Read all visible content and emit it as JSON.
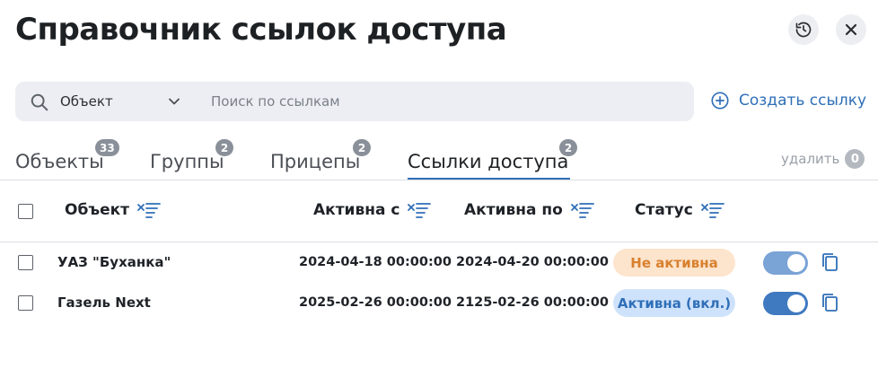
{
  "header": {
    "title": "Справочник ссылок доступа"
  },
  "search": {
    "object_label": "Объект",
    "placeholder": "Поиск по ссылкам"
  },
  "actions": {
    "create_label": "Создать ссылку",
    "delete_label": "удалить",
    "delete_count": "0"
  },
  "tabs": [
    {
      "label": "Объекты",
      "count": "33",
      "active": false
    },
    {
      "label": "Группы",
      "count": "2",
      "active": false
    },
    {
      "label": "Прицепы",
      "count": "2",
      "active": false
    },
    {
      "label": "Ссылки доступа",
      "count": "2",
      "active": true
    }
  ],
  "table": {
    "columns": [
      "Объект",
      "Активна с",
      "Активна по",
      "Статус"
    ],
    "rows": [
      {
        "object": "УАЗ \"Буханка\"",
        "active_from": "2024-04-18 00:00:00",
        "active_to": "2024-04-20 00:00:00",
        "status": "Не активна",
        "status_type": "inactive",
        "enabled": true
      },
      {
        "object": "Газель Next",
        "active_from": "2025-02-26 00:00:00",
        "active_to": "2125-02-26 00:00:00",
        "status": "Активна (вкл.)",
        "status_type": "active",
        "enabled": true
      }
    ]
  },
  "colors": {
    "accent": "#2f6fb8",
    "inactive_pill_bg": "#fde4cc",
    "inactive_pill_text": "#d8802e",
    "active_pill_bg": "#cfe2fb"
  },
  "icons": [
    "history-icon",
    "close-icon",
    "search-icon",
    "chevron-down-icon",
    "plus-circle-icon",
    "filter-sort-icon",
    "copy-icon"
  ]
}
